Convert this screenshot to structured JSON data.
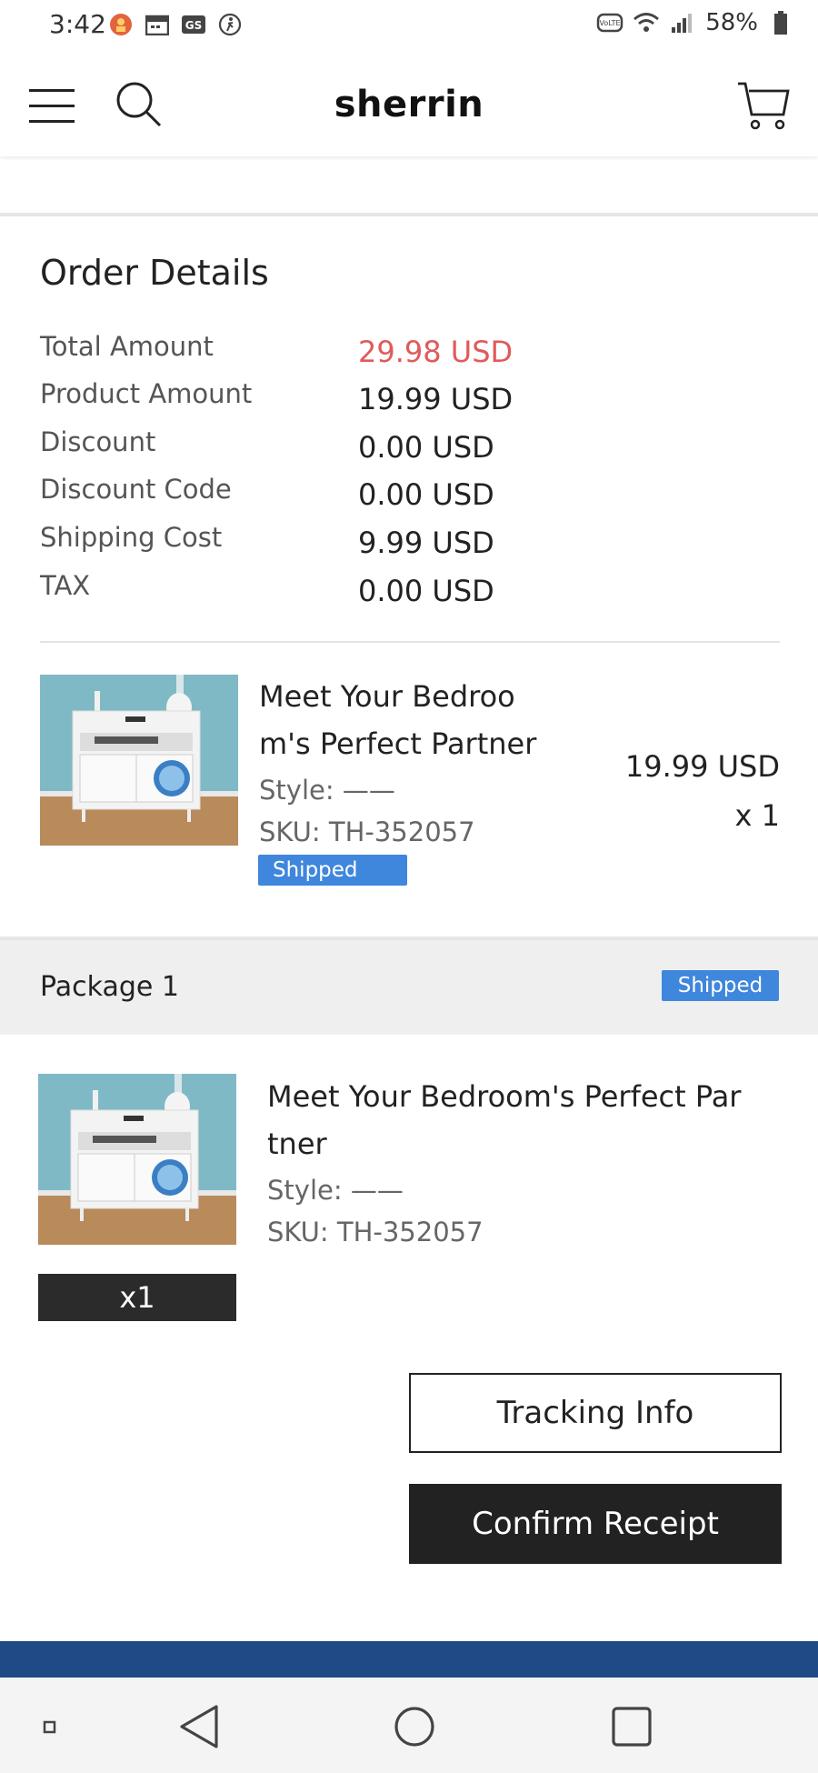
{
  "status_bar": {
    "time": "3:42",
    "battery_percent": "58%",
    "left_icons": [
      "app-notification-icon",
      "calendar-icon",
      "gs-icon",
      "accessibility-icon"
    ],
    "right_icons": [
      "volte-icon",
      "wifi-icon",
      "signal-icon",
      "battery-icon"
    ]
  },
  "header": {
    "brand": "sherrin",
    "icons": [
      "menu-icon",
      "search-icon",
      "cart-icon"
    ]
  },
  "order_details": {
    "title": "Order Details",
    "rows": [
      {
        "label": "Total Amount",
        "value": "29.98 USD"
      },
      {
        "label": "Product Amount",
        "value": "19.99 USD"
      },
      {
        "label": "Discount",
        "value": "0.00 USD"
      },
      {
        "label": "Discount Code",
        "value": "0.00 USD"
      },
      {
        "label": "Shipping Cost",
        "value": "9.99 USD"
      },
      {
        "label": "TAX",
        "value": "0.00 USD"
      }
    ],
    "total_color": "#e05a5a"
  },
  "order_item": {
    "title_line1": "Meet Your Bedroo",
    "title_line2": "m's Perfect Partner",
    "style": "Style: ——",
    "sku": "SKU: TH-352057",
    "status": "Shipped",
    "price": "19.99 USD",
    "quantity": "x 1"
  },
  "package": {
    "label": "Package 1",
    "status": "Shipped",
    "item": {
      "title_line1": "Meet Your Bedroom's Perfect Par",
      "title_line2": "tner",
      "style": "Style: ——",
      "sku": "SKU: TH-352057",
      "quantity": "x1"
    }
  },
  "actions": {
    "tracking_label": "Tracking Info",
    "confirm_label": "Confirm Receipt"
  },
  "colors": {
    "accent_blue": "#3f86dd",
    "footer_blue": "#1f4a86",
    "dark_button": "#222222"
  }
}
